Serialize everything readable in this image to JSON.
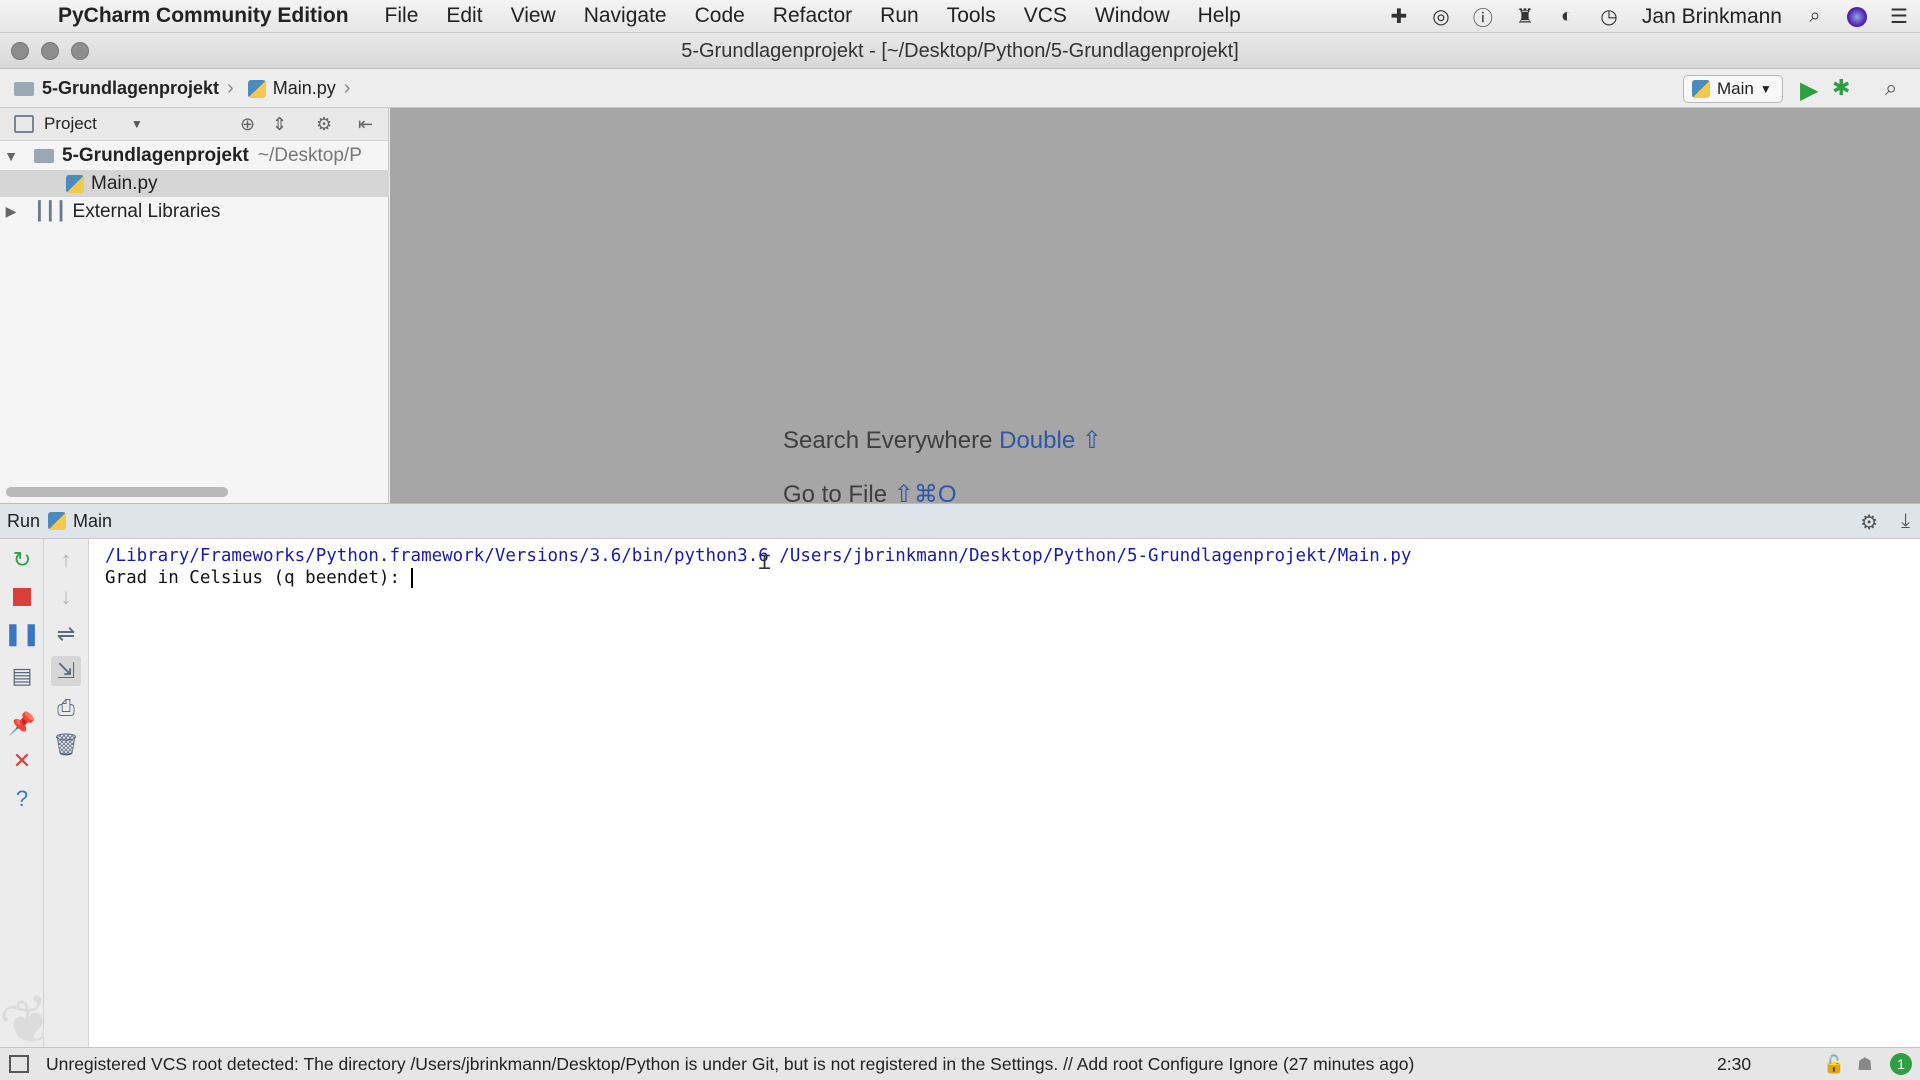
{
  "menubar": {
    "app_name": "PyCharm Community Edition",
    "items": [
      "File",
      "Edit",
      "View",
      "Navigate",
      "Code",
      "Refactor",
      "Run",
      "Tools",
      "VCS",
      "Window",
      "Help"
    ],
    "user": "Jan Brinkmann"
  },
  "window": {
    "title": "5-Grundlagenprojekt - [~/Desktop/Python/5-Grundlagenprojekt]"
  },
  "navbar": {
    "project": "5-Grundlagenprojekt",
    "file": "Main.py",
    "run_config": "Main"
  },
  "project_panel": {
    "view_selector": "Project",
    "root_name": "5-Grundlagenprojekt",
    "root_path": "~/Desktop/P",
    "file": "Main.py",
    "external": "External Libraries"
  },
  "editor_hints": {
    "search_label": "Search Everywhere",
    "search_key": "Double ⇧",
    "goto_label": "Go to File",
    "goto_key": "⇧⌘O"
  },
  "run_panel": {
    "tab_label": "Run",
    "config": "Main",
    "console_lines": [
      "/Library/Frameworks/Python.framework/Versions/3.6/bin/python3.6 /Users/jbrinkmann/Desktop/Python/5-Grundlagenprojekt/Main.py",
      "Grad in Celsius (q beendet): "
    ]
  },
  "statusbar": {
    "message": "Unregistered VCS root detected: The directory /Users/jbrinkmann/Desktop/Python is under Git, but is not registered in the Settings. // Add root  Configure  Ignore (27 minutes ago)",
    "position": "2:30"
  },
  "colors": {
    "run_green": "#2ea043",
    "stop_red": "#d9403a",
    "editor_bg": "#a6a6a6",
    "hint_key_blue": "#2f56a8"
  }
}
